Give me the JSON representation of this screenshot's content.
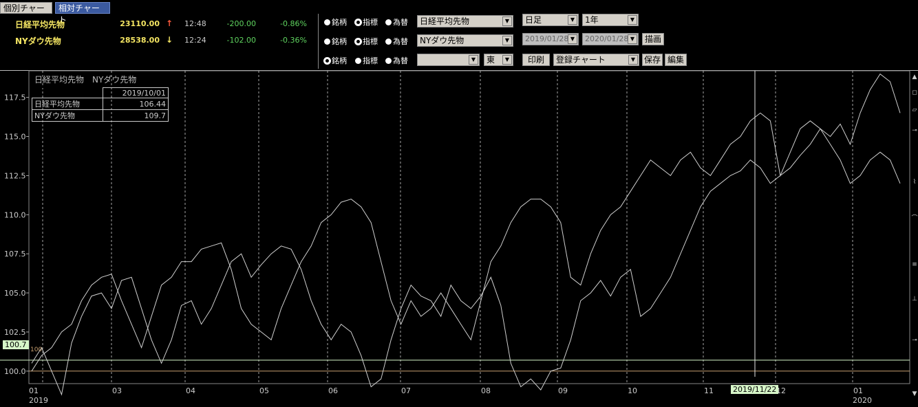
{
  "tabs": [
    {
      "label": "個別チャート",
      "active": true
    },
    {
      "label": "相対チャート",
      "active": false
    }
  ],
  "quotes": [
    {
      "name": "日経平均先物",
      "price": "23110.00",
      "arrow": "↑",
      "time": "12:48",
      "change": "-200.00",
      "pct": "-0.86%"
    },
    {
      "name": "NYダウ先物",
      "price": "28538.00",
      "arrow": "↓",
      "time": "12:24",
      "change": "-102.00",
      "pct": "-0.36%"
    }
  ],
  "selector_rows": [
    {
      "opt1": "銘柄",
      "opt2": "指標",
      "opt3": "為替",
      "selected": 1,
      "combo": "日経平均先物"
    },
    {
      "opt1": "銘柄",
      "opt2": "指標",
      "opt3": "為替",
      "selected": 1,
      "combo": "NYダウ先物"
    },
    {
      "opt1": "銘柄",
      "opt2": "指標",
      "opt3": "為替",
      "selected": 0,
      "combo": "",
      "market": "東"
    }
  ],
  "controls": {
    "period_type": "日足",
    "period_range": "1年",
    "date_from": "2019/01/28",
    "date_to": "2020/01/28",
    "draw_button": "描画",
    "print_button": "印刷",
    "registered_chart": "登録チャート",
    "save_button": "保存",
    "edit_button": "編集"
  },
  "chart_header": "日経平均先物　NYダウ先物",
  "legend": {
    "date": "2019/10/01",
    "rows": [
      {
        "name": "日経平均先物",
        "value": "106.44"
      },
      {
        "name": "NYダウ先物",
        "value": "109.7"
      }
    ]
  },
  "markers": {
    "left_value": "100.7",
    "line_label": "100",
    "cursor_date": "2019/11/22"
  },
  "colors": {
    "line": "#cfcfcf",
    "grid": "#cfcfcf",
    "highlight_line": "#c8a070",
    "cursor_box": "#d6f5c8"
  },
  "chart_data": {
    "type": "line",
    "ylim": [
      99.2,
      119.2
    ],
    "yticks": [
      "100.0",
      "102.5",
      "105.0",
      "107.5",
      "110.0",
      "112.5",
      "115.0",
      "117.5"
    ],
    "xticks": [
      "01",
      "03",
      "04",
      "05",
      "06",
      "07",
      "08",
      "09",
      "10",
      "11",
      "12",
      "01"
    ],
    "year_labels": [
      "2019",
      "2020"
    ],
    "series": [
      {
        "name": "日経平均先物",
        "values": [
          100.5,
          101.5,
          100.0,
          98.5,
          101.8,
          103.5,
          104.8,
          105.0,
          104.0,
          105.8,
          106.0,
          104.0,
          102.0,
          100.5,
          102.0,
          104.2,
          104.5,
          103.0,
          104.0,
          105.5,
          107.0,
          107.5,
          106.0,
          106.8,
          107.5,
          108.0,
          107.8,
          106.5,
          104.5,
          103.0,
          102.0,
          103.0,
          102.5,
          101.0,
          99.0,
          99.5,
          102.0,
          104.0,
          105.5,
          104.8,
          104.5,
          103.5,
          105.5,
          104.5,
          104.0,
          104.8,
          106.0,
          104.2,
          100.5,
          99.0,
          99.5,
          98.8,
          100.0,
          100.2,
          102.0,
          104.5,
          105.0,
          105.8,
          104.8,
          106.0,
          106.5,
          103.5,
          104.0,
          105.0,
          106.0,
          107.5,
          109.0,
          110.5,
          111.5,
          112.0,
          112.5,
          112.8,
          113.5,
          113.0,
          112.0,
          112.5,
          113.0,
          113.8,
          114.5,
          115.5,
          115.0,
          115.8,
          114.5,
          116.5,
          118.0,
          119.0,
          118.5,
          116.5
        ]
      },
      {
        "name": "NYダウ先物",
        "values": [
          100.0,
          101.0,
          101.5,
          102.5,
          103.0,
          104.5,
          105.5,
          106.0,
          106.2,
          104.5,
          103.0,
          101.5,
          103.5,
          105.5,
          106.0,
          107.0,
          107.0,
          107.8,
          108.0,
          108.2,
          106.5,
          104.0,
          103.0,
          102.5,
          102.0,
          104.0,
          105.5,
          107.0,
          108.0,
          109.5,
          110.0,
          110.8,
          111.0,
          110.5,
          109.5,
          107.0,
          104.5,
          103.0,
          104.5,
          103.5,
          104.0,
          105.0,
          104.0,
          103.0,
          102.0,
          104.5,
          107.0,
          108.0,
          109.5,
          110.5,
          111.0,
          111.0,
          110.5,
          109.5,
          106.0,
          105.5,
          107.5,
          109.0,
          110.0,
          110.5,
          111.5,
          112.5,
          113.5,
          113.0,
          112.5,
          113.5,
          114.0,
          113.0,
          112.5,
          113.5,
          114.5,
          115.0,
          116.0,
          116.5,
          116.0,
          112.5,
          114.0,
          115.5,
          116.0,
          115.5,
          114.5,
          113.5,
          112.0,
          112.5,
          113.5,
          114.0,
          113.5,
          112.0
        ]
      }
    ],
    "highlight_value": 100.0,
    "cursor_date": "2019/11/22"
  }
}
